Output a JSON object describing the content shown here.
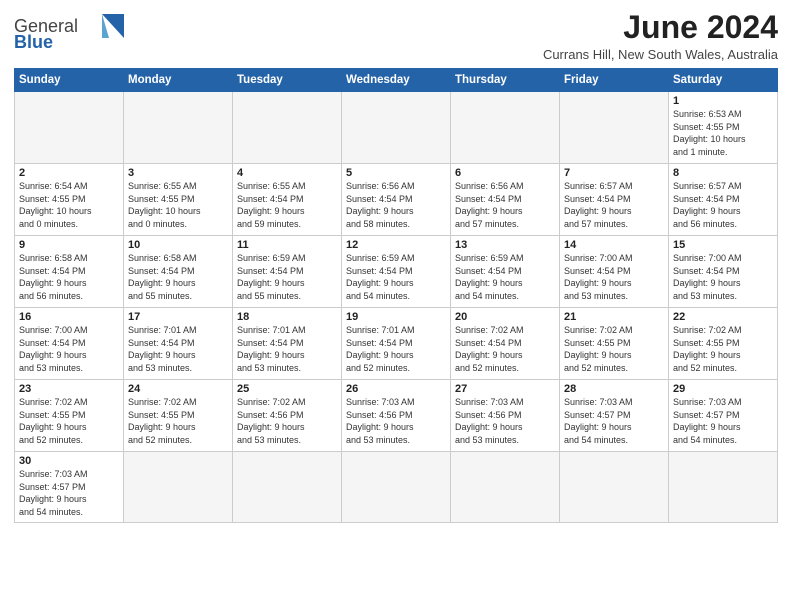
{
  "header": {
    "logo_general": "General",
    "logo_blue": "Blue",
    "month_title": "June 2024",
    "subtitle": "Currans Hill, New South Wales, Australia"
  },
  "weekdays": [
    "Sunday",
    "Monday",
    "Tuesday",
    "Wednesday",
    "Thursday",
    "Friday",
    "Saturday"
  ],
  "weeks": [
    [
      {
        "day": "",
        "info": ""
      },
      {
        "day": "",
        "info": ""
      },
      {
        "day": "",
        "info": ""
      },
      {
        "day": "",
        "info": ""
      },
      {
        "day": "",
        "info": ""
      },
      {
        "day": "",
        "info": ""
      },
      {
        "day": "1",
        "info": "Sunrise: 6:53 AM\nSunset: 4:55 PM\nDaylight: 10 hours\nand 1 minute."
      }
    ],
    [
      {
        "day": "2",
        "info": "Sunrise: 6:54 AM\nSunset: 4:55 PM\nDaylight: 10 hours\nand 0 minutes."
      },
      {
        "day": "3",
        "info": "Sunrise: 6:55 AM\nSunset: 4:55 PM\nDaylight: 10 hours\nand 0 minutes."
      },
      {
        "day": "4",
        "info": "Sunrise: 6:55 AM\nSunset: 4:54 PM\nDaylight: 9 hours\nand 59 minutes."
      },
      {
        "day": "5",
        "info": "Sunrise: 6:56 AM\nSunset: 4:54 PM\nDaylight: 9 hours\nand 58 minutes."
      },
      {
        "day": "6",
        "info": "Sunrise: 6:56 AM\nSunset: 4:54 PM\nDaylight: 9 hours\nand 57 minutes."
      },
      {
        "day": "7",
        "info": "Sunrise: 6:57 AM\nSunset: 4:54 PM\nDaylight: 9 hours\nand 57 minutes."
      },
      {
        "day": "8",
        "info": "Sunrise: 6:57 AM\nSunset: 4:54 PM\nDaylight: 9 hours\nand 56 minutes."
      }
    ],
    [
      {
        "day": "9",
        "info": "Sunrise: 6:58 AM\nSunset: 4:54 PM\nDaylight: 9 hours\nand 56 minutes."
      },
      {
        "day": "10",
        "info": "Sunrise: 6:58 AM\nSunset: 4:54 PM\nDaylight: 9 hours\nand 55 minutes."
      },
      {
        "day": "11",
        "info": "Sunrise: 6:59 AM\nSunset: 4:54 PM\nDaylight: 9 hours\nand 55 minutes."
      },
      {
        "day": "12",
        "info": "Sunrise: 6:59 AM\nSunset: 4:54 PM\nDaylight: 9 hours\nand 54 minutes."
      },
      {
        "day": "13",
        "info": "Sunrise: 6:59 AM\nSunset: 4:54 PM\nDaylight: 9 hours\nand 54 minutes."
      },
      {
        "day": "14",
        "info": "Sunrise: 7:00 AM\nSunset: 4:54 PM\nDaylight: 9 hours\nand 53 minutes."
      },
      {
        "day": "15",
        "info": "Sunrise: 7:00 AM\nSunset: 4:54 PM\nDaylight: 9 hours\nand 53 minutes."
      }
    ],
    [
      {
        "day": "16",
        "info": "Sunrise: 7:00 AM\nSunset: 4:54 PM\nDaylight: 9 hours\nand 53 minutes."
      },
      {
        "day": "17",
        "info": "Sunrise: 7:01 AM\nSunset: 4:54 PM\nDaylight: 9 hours\nand 53 minutes."
      },
      {
        "day": "18",
        "info": "Sunrise: 7:01 AM\nSunset: 4:54 PM\nDaylight: 9 hours\nand 53 minutes."
      },
      {
        "day": "19",
        "info": "Sunrise: 7:01 AM\nSunset: 4:54 PM\nDaylight: 9 hours\nand 52 minutes."
      },
      {
        "day": "20",
        "info": "Sunrise: 7:02 AM\nSunset: 4:54 PM\nDaylight: 9 hours\nand 52 minutes."
      },
      {
        "day": "21",
        "info": "Sunrise: 7:02 AM\nSunset: 4:55 PM\nDaylight: 9 hours\nand 52 minutes."
      },
      {
        "day": "22",
        "info": "Sunrise: 7:02 AM\nSunset: 4:55 PM\nDaylight: 9 hours\nand 52 minutes."
      }
    ],
    [
      {
        "day": "23",
        "info": "Sunrise: 7:02 AM\nSunset: 4:55 PM\nDaylight: 9 hours\nand 52 minutes."
      },
      {
        "day": "24",
        "info": "Sunrise: 7:02 AM\nSunset: 4:55 PM\nDaylight: 9 hours\nand 52 minutes."
      },
      {
        "day": "25",
        "info": "Sunrise: 7:02 AM\nSunset: 4:56 PM\nDaylight: 9 hours\nand 53 minutes."
      },
      {
        "day": "26",
        "info": "Sunrise: 7:03 AM\nSunset: 4:56 PM\nDaylight: 9 hours\nand 53 minutes."
      },
      {
        "day": "27",
        "info": "Sunrise: 7:03 AM\nSunset: 4:56 PM\nDaylight: 9 hours\nand 53 minutes."
      },
      {
        "day": "28",
        "info": "Sunrise: 7:03 AM\nSunset: 4:57 PM\nDaylight: 9 hours\nand 54 minutes."
      },
      {
        "day": "29",
        "info": "Sunrise: 7:03 AM\nSunset: 4:57 PM\nDaylight: 9 hours\nand 54 minutes."
      }
    ],
    [
      {
        "day": "30",
        "info": "Sunrise: 7:03 AM\nSunset: 4:57 PM\nDaylight: 9 hours\nand 54 minutes."
      },
      {
        "day": "",
        "info": ""
      },
      {
        "day": "",
        "info": ""
      },
      {
        "day": "",
        "info": ""
      },
      {
        "day": "",
        "info": ""
      },
      {
        "day": "",
        "info": ""
      },
      {
        "day": "",
        "info": ""
      }
    ]
  ]
}
